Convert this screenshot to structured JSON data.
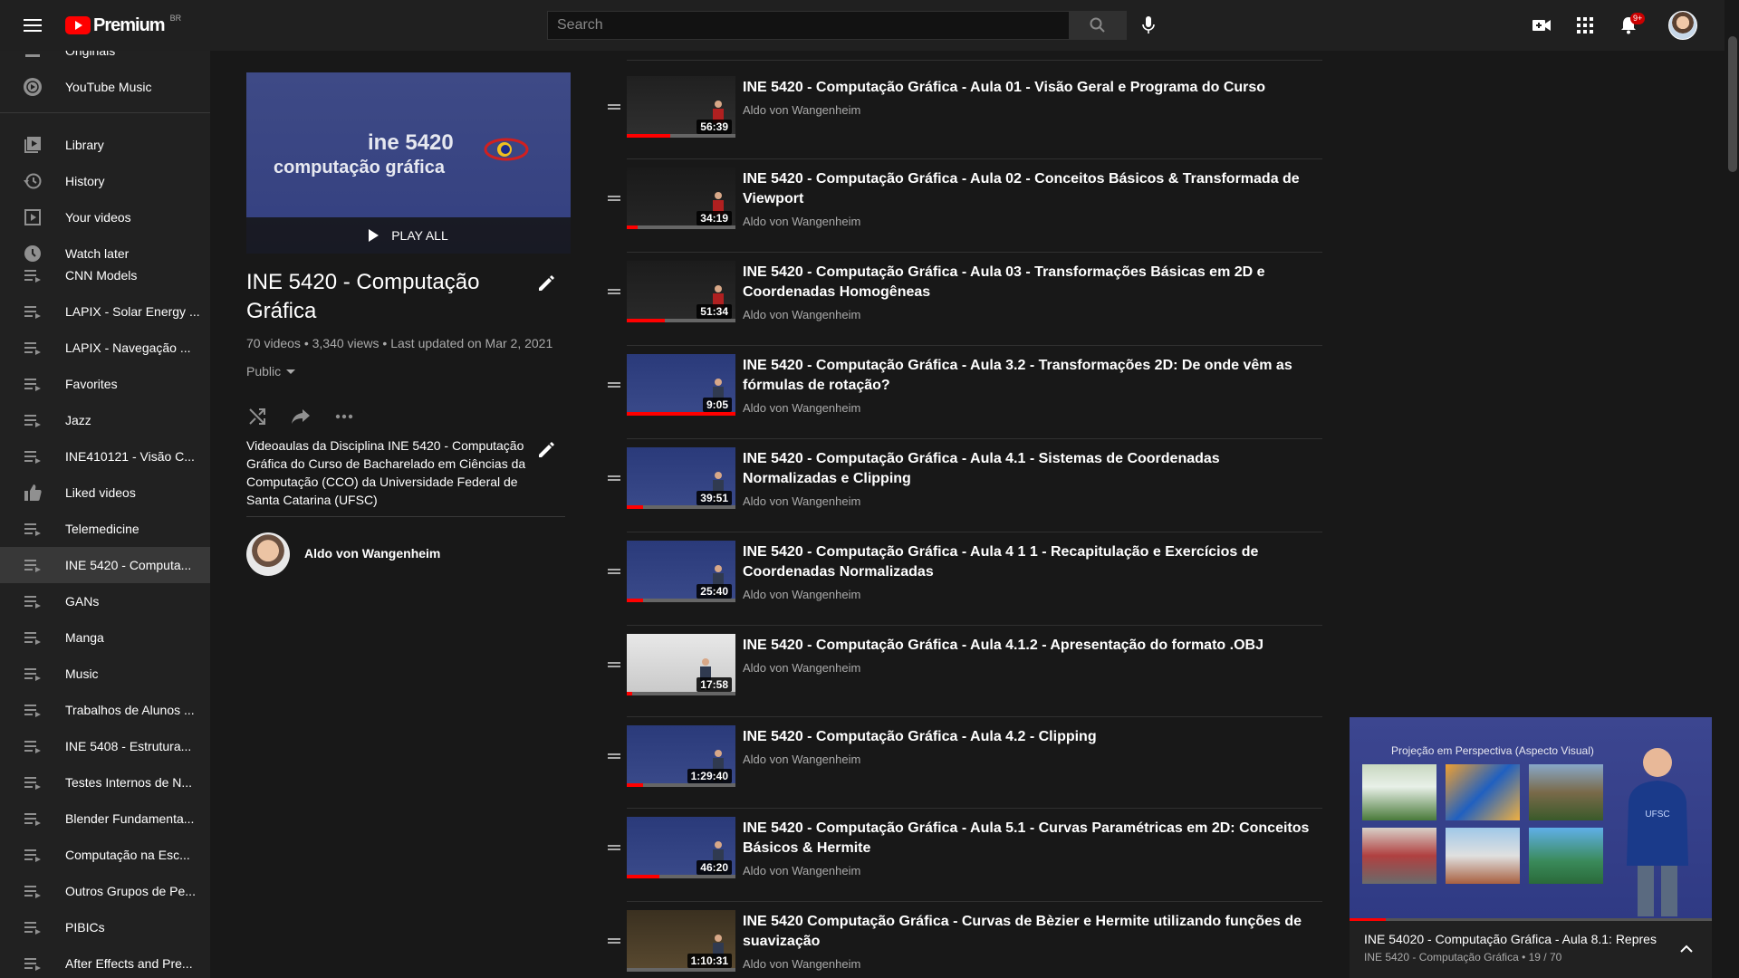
{
  "header": {
    "logo_text": "Premium",
    "region": "BR",
    "search_placeholder": "Search",
    "notification_count": "9+"
  },
  "sidebar": {
    "items": [
      {
        "label": "Originals",
        "icon": "originals-icon"
      },
      {
        "label": "YouTube Music",
        "icon": "youtube-music-icon"
      },
      {
        "label": "Library",
        "icon": "library-icon"
      },
      {
        "label": "History",
        "icon": "history-icon"
      },
      {
        "label": "Your videos",
        "icon": "your-videos-icon"
      },
      {
        "label": "Watch later",
        "icon": "clock-icon"
      },
      {
        "label": "CNN Models",
        "icon": "playlist-icon"
      },
      {
        "label": "LAPIX - Solar Energy ...",
        "icon": "playlist-icon"
      },
      {
        "label": "LAPIX - Navegação ...",
        "icon": "playlist-icon"
      },
      {
        "label": "Favorites",
        "icon": "playlist-icon"
      },
      {
        "label": "Jazz",
        "icon": "playlist-icon"
      },
      {
        "label": "INE410121 - Visão C...",
        "icon": "playlist-icon"
      },
      {
        "label": "Liked videos",
        "icon": "thumbs-up-icon"
      },
      {
        "label": "Telemedicine",
        "icon": "playlist-icon"
      },
      {
        "label": "INE 5420 - Computa...",
        "icon": "playlist-icon"
      },
      {
        "label": "GANs",
        "icon": "playlist-icon"
      },
      {
        "label": "Manga",
        "icon": "playlist-icon"
      },
      {
        "label": "Music",
        "icon": "playlist-icon"
      },
      {
        "label": "Trabalhos de Alunos ...",
        "icon": "playlist-icon"
      },
      {
        "label": "INE 5408 - Estrutura...",
        "icon": "playlist-icon"
      },
      {
        "label": "Testes Internos de N...",
        "icon": "playlist-icon"
      },
      {
        "label": "Blender Fundamenta...",
        "icon": "playlist-icon"
      },
      {
        "label": "Computação na Esc...",
        "icon": "playlist-icon"
      },
      {
        "label": "Outros Grupos de Pe...",
        "icon": "playlist-icon"
      },
      {
        "label": "PIBICs",
        "icon": "playlist-icon"
      },
      {
        "label": "After Effects and Pre...",
        "icon": "playlist-icon"
      }
    ]
  },
  "playlist": {
    "thumb_line1": "ine 5420",
    "thumb_line2": "computação gráfica",
    "play_all": "PLAY ALL",
    "title": "INE 5420 - Computação Gráfica",
    "stats": "70 videos • 3,340 views • Last updated on Mar 2, 2021",
    "privacy": "Public",
    "description": "Videoaulas da Disciplina INE 5420 - Computação Gráfica do Curso de Bacharelado em Ciências da Computação (CCO) da Universidade Federal de Santa Catarina (UFSC)",
    "owner": "Aldo von Wangenheim"
  },
  "videos": [
    {
      "title": "INE 5420 - Computação Gráfica - Aula 01 - Visão Geral e Programa do Curso",
      "channel": "Aldo von Wangenheim",
      "duration": "56:39",
      "watched": 0.4
    },
    {
      "title": "INE 5420 - Computação Gráfica - Aula 02 - Conceitos Básicos & Transformada de Viewport",
      "channel": "Aldo von Wangenheim",
      "duration": "34:19",
      "watched": 0.1
    },
    {
      "title": "INE 5420 - Computação Gráfica - Aula 03 - Transformações Básicas em 2D e Coordenadas Homogêneas",
      "channel": "Aldo von Wangenheim",
      "duration": "51:34",
      "watched": 0.35
    },
    {
      "title": "INE 5420 - Computação Gráfica - Aula 3.2 - Transformações 2D: De onde vêm as fórmulas de rotação?",
      "channel": "Aldo von Wangenheim",
      "duration": "9:05",
      "watched": 1.0
    },
    {
      "title": "INE 5420 - Computação Gráfica - Aula 4.1 - Sistemas de Coordenadas Normalizadas e Clipping",
      "channel": "Aldo von Wangenheim",
      "duration": "39:51",
      "watched": 0.15
    },
    {
      "title": "INE 5420 - Computação Gráfica - Aula 4 1 1 - Recapitulação e Exercícios de Coordenadas Normalizadas",
      "channel": "Aldo von Wangenheim",
      "duration": "25:40",
      "watched": 0.15
    },
    {
      "title": "INE 5420 - Computação Gráfica - Aula 4.1.2 - Apresentação do formato .OBJ",
      "channel": "Aldo von Wangenheim",
      "duration": "17:58",
      "watched": 0.05
    },
    {
      "title": "INE 5420 - Computação Gráfica - Aula 4.2 - Clipping",
      "channel": "Aldo von Wangenheim",
      "duration": "1:29:40",
      "watched": 0.15
    },
    {
      "title": "INE 5420 - Computação Gráfica - Aula 5.1 - Curvas Paramétricas em 2D: Conceitos Básicos & Hermite",
      "channel": "Aldo von Wangenheim",
      "duration": "46:20",
      "watched": 0.3
    },
    {
      "title": "INE 5420 Computação Gráfica - Curvas de Bèzier e Hermite utilizando funções de suavização",
      "channel": "Aldo von Wangenheim",
      "duration": "1:10:31",
      "watched": 0.0
    }
  ],
  "miniplayer": {
    "heading": "Projeção em Perspectiva (Aspecto Visual)",
    "title": "INE 54020 - Computação Gráfica - Aula 8.1:  Repres",
    "subtitle": "INE 5420 - Computação Gráfica • 19 / 70",
    "progress": 0.1
  },
  "colors": {
    "accent": "#ff0000",
    "background": "#181818",
    "sidebar": "#212121",
    "header": "#202020"
  }
}
